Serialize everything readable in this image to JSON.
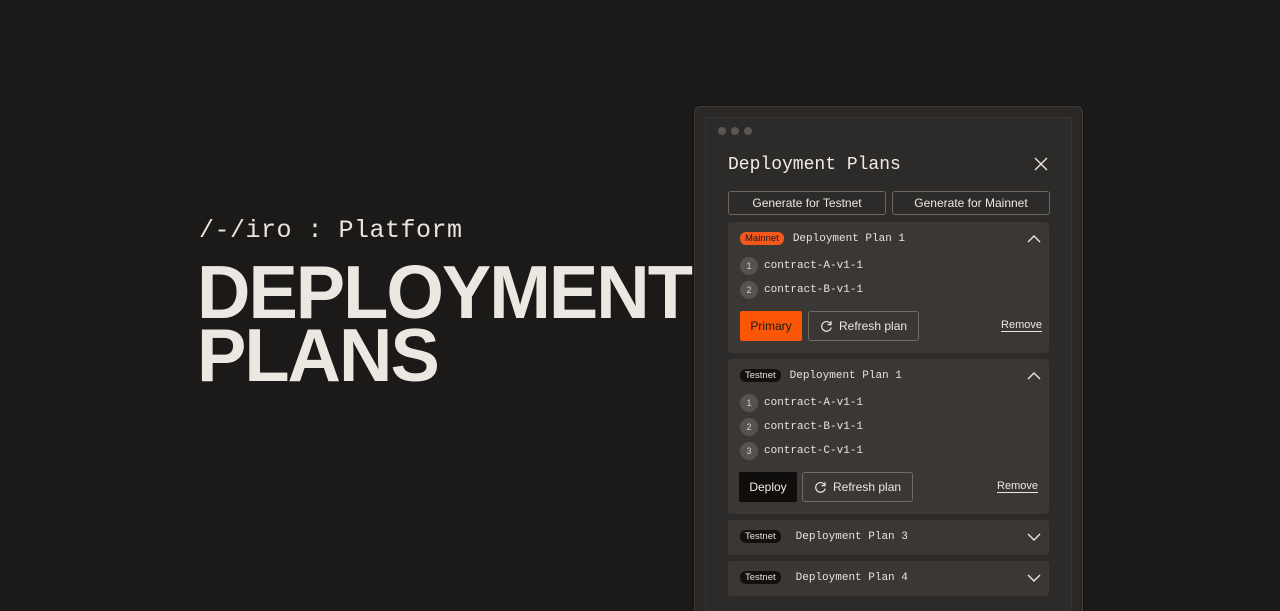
{
  "brand": {
    "text": "/-/iro : Platform"
  },
  "hero": {
    "line1": "DEPLOYMENT",
    "line2": "PLANS"
  },
  "panel": {
    "title": "Deployment Plans",
    "generate_testnet": "Generate for Testnet",
    "generate_mainnet": "Generate for Mainnet"
  },
  "plans": [
    {
      "network": "Mainnet",
      "name": "Deployment Plan 1",
      "expanded": true,
      "contracts": [
        {
          "index": "1",
          "name": "contract-A-v1-1"
        },
        {
          "index": "2",
          "name": "contract-B-v1-1"
        }
      ],
      "primary_label": "Primary",
      "refresh_label": "Refresh plan",
      "remove_label": "Remove"
    },
    {
      "network": "Testnet",
      "name": "Deployment Plan 1",
      "expanded": true,
      "contracts": [
        {
          "index": "1",
          "name": "contract-A-v1-1"
        },
        {
          "index": "2",
          "name": "contract-B-v1-1"
        },
        {
          "index": "3",
          "name": "contract-C-v1-1"
        }
      ],
      "primary_label": "Deploy",
      "refresh_label": "Refresh plan",
      "remove_label": "Remove"
    },
    {
      "network": "Testnet",
      "name": "Deployment Plan 3",
      "expanded": false
    },
    {
      "network": "Testnet",
      "name": "Deployment Plan 4",
      "expanded": false
    }
  ],
  "colors": {
    "accent": "#fb5607",
    "background": "#1b1a19",
    "panel": "#2d2b29",
    "card": "#3a3734"
  },
  "icons": {
    "close": "close-icon",
    "collapse": "chevron-up-icon",
    "expand": "chevron-down-icon",
    "refresh": "refresh-icon"
  }
}
